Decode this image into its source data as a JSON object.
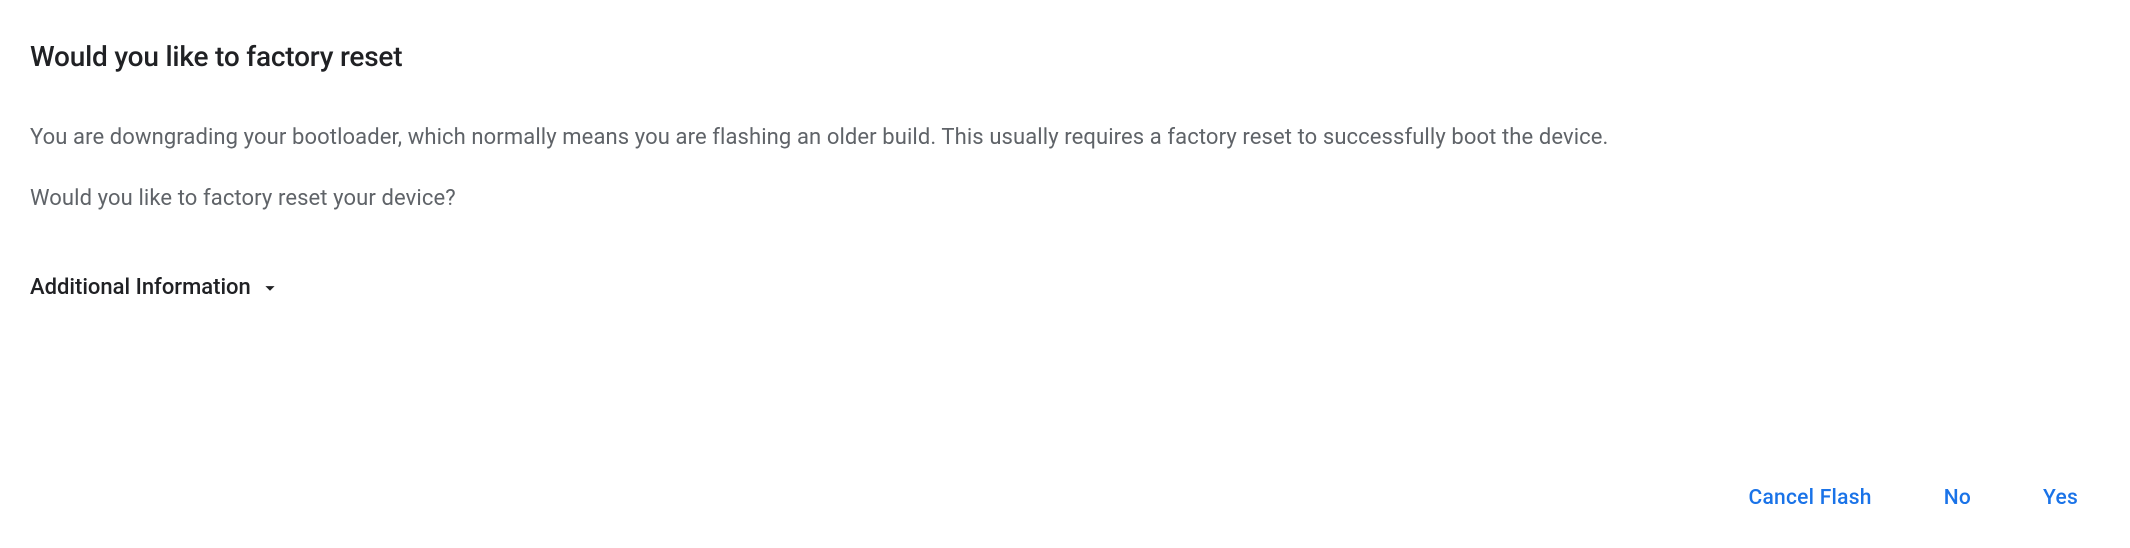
{
  "dialog": {
    "title": "Would you like to factory reset",
    "body1": "You are downgrading your bootloader, which normally means you are flashing an older build. This usually requires a factory reset to successfully boot the device.",
    "body2": "Would you like to factory reset your device?",
    "additional_info_label": "Additional Information"
  },
  "buttons": {
    "cancel": "Cancel Flash",
    "no": "No",
    "yes": "Yes"
  }
}
